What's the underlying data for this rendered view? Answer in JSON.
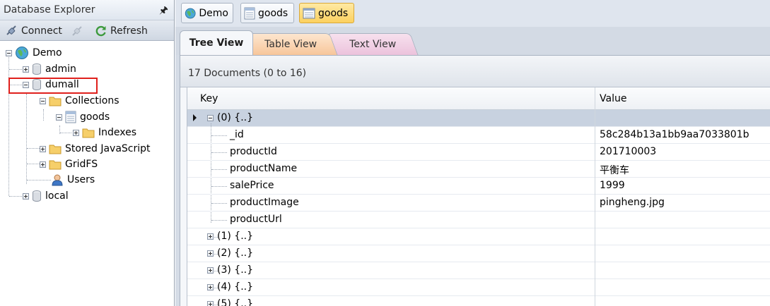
{
  "explorer": {
    "title": "Database Explorer",
    "pin_icon": "pin-icon",
    "toolbar": {
      "connect_label": "Connect",
      "refresh_label": "Refresh"
    },
    "tree": {
      "root": "Demo",
      "db_admin": "admin",
      "db_dumall": "dumall",
      "collections": "Collections",
      "goods": "goods",
      "indexes": "Indexes",
      "stored_js": "Stored JavaScript",
      "gridfs": "GridFS",
      "users": "Users",
      "db_local": "local"
    }
  },
  "doc_tabs": [
    {
      "label": "Demo",
      "icon": "server-globe-icon",
      "active": false
    },
    {
      "label": "goods",
      "icon": "collection-icon",
      "active": false
    },
    {
      "label": "goods",
      "icon": "collection-icon",
      "active": true
    }
  ],
  "view_tabs": {
    "tree": "Tree View",
    "table": "Table View",
    "text": "Text View"
  },
  "doc_count": "17 Documents (0 to 16)",
  "grid": {
    "col_key": "Key",
    "col_value": "Value",
    "rows": [
      {
        "key": "(0) {..}",
        "value": ""
      },
      {
        "key": "_id",
        "value": "58c284b13a1bb9aa7033801b"
      },
      {
        "key": "productId",
        "value": "201710003"
      },
      {
        "key": "productName",
        "value": "平衡车"
      },
      {
        "key": "salePrice",
        "value": "1999"
      },
      {
        "key": "productImage",
        "value": "pingheng.jpg"
      },
      {
        "key": "productUrl",
        "value": ""
      },
      {
        "key": "(1) {..}",
        "value": ""
      },
      {
        "key": "(2) {..}",
        "value": ""
      },
      {
        "key": "(3) {..}",
        "value": ""
      },
      {
        "key": "(4) {..}",
        "value": ""
      },
      {
        "key": "(5) {..}",
        "value": ""
      }
    ]
  },
  "colors": {
    "active_tab": "#fcd15f",
    "selected_row": "#c8d2e0",
    "highlight_box": "#e0201c"
  }
}
